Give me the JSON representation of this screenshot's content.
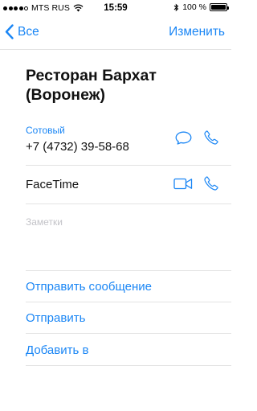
{
  "status_bar": {
    "carrier": "MTS RUS",
    "time": "15:59",
    "battery_percent": "100 %",
    "battery_level": 1.0,
    "icons": [
      "signal-dots-icon",
      "wifi-icon",
      "bluetooth-icon",
      "battery-icon"
    ]
  },
  "nav": {
    "back_label": "Все",
    "edit_label": "Изменить"
  },
  "contact": {
    "name_line1": "Ресторан Бархат",
    "name_line2": "(Воронеж)"
  },
  "phone": {
    "label": "Сотовый",
    "number": "+7 (4732) 39-58-68"
  },
  "facetime": {
    "label": "FaceTime"
  },
  "notes": {
    "placeholder": "Заметки"
  },
  "actions": {
    "send_message": "Отправить сообщение",
    "share": "Отправить",
    "add_to": "Добавить в"
  },
  "colors": {
    "accent": "#1a86f5",
    "divider": "#e3e3e3",
    "placeholder": "#c3c3c8"
  }
}
